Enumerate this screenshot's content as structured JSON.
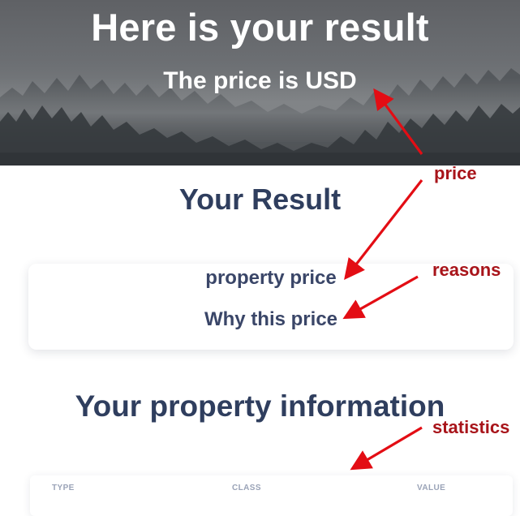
{
  "hero": {
    "title": "Here is your result",
    "subtitle": "The price is USD"
  },
  "result_section": {
    "heading": "Your Result",
    "lines": [
      "property price",
      "Why this price"
    ]
  },
  "property_section": {
    "heading": "Your property information",
    "table_headers": [
      "TYPE",
      "CLASS",
      "VALUE"
    ]
  },
  "annotations": {
    "price": "price",
    "reasons": "reasons",
    "statistics": "statistics"
  },
  "colors": {
    "heading": "#2f3e5e",
    "card_text": "#3a4668",
    "annotation": "#a8141a",
    "arrow": "#e30d14"
  }
}
